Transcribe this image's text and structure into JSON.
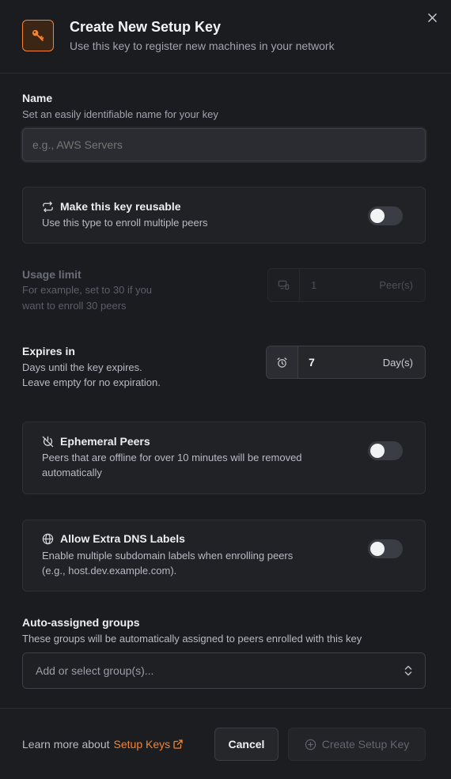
{
  "header": {
    "title": "Create New Setup Key",
    "subtitle": "Use this key to register new machines in your network"
  },
  "name_field": {
    "label": "Name",
    "hint": "Set an easily identifiable name for your key",
    "placeholder": "e.g., AWS Servers",
    "value": ""
  },
  "reusable": {
    "title": "Make this key reusable",
    "desc": "Use this type to enroll multiple peers",
    "enabled": false
  },
  "usage_limit": {
    "label": "Usage limit",
    "hint_line1": "For example, set to 30 if you",
    "hint_line2": "want to enroll 30 peers",
    "value": "1",
    "unit": "Peer(s)"
  },
  "expires": {
    "label": "Expires in",
    "hint_line1": "Days until the key expires.",
    "hint_line2": "Leave empty for no expiration.",
    "value": "7",
    "unit": "Day(s)"
  },
  "ephemeral": {
    "title": "Ephemeral Peers",
    "desc_line1": "Peers that are offline for over 10 minutes will be removed",
    "desc_line2": "automatically",
    "enabled": false
  },
  "dns_labels": {
    "title": "Allow Extra DNS Labels",
    "desc_line1": "Enable multiple subdomain labels when enrolling peers",
    "desc_line2": "(e.g., host.dev.example.com).",
    "enabled": false
  },
  "groups": {
    "label": "Auto-assigned groups",
    "hint": "These groups will be automatically assigned to peers enrolled with this key",
    "placeholder": "Add or select group(s)..."
  },
  "footer": {
    "learn_more": "Learn more about",
    "link_label": "Setup Keys",
    "cancel_label": "Cancel",
    "create_label": "Create Setup Key"
  },
  "colors": {
    "accent": "#f68330",
    "background": "#1b1c20"
  },
  "icons": [
    "key-icon",
    "close-icon",
    "repeat-icon",
    "devices-icon",
    "alarm-clock-icon",
    "power-off-icon",
    "globe-icon",
    "chevron-updown-icon",
    "external-link-icon",
    "plus-circle-icon"
  ]
}
